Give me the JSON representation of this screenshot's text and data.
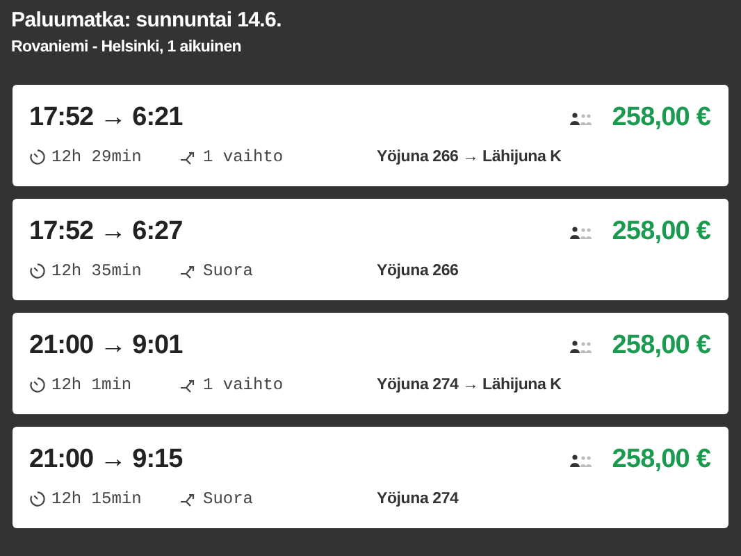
{
  "header": {
    "title": "Paluumatka: sunnuntai 14.6.",
    "subtitle": "Rovaniemi - Helsinki, 1 aikuinen"
  },
  "connections": [
    {
      "times": "17:52 → 6:21",
      "price": "258,00 €",
      "duration": "12h 29min",
      "transfers": "1 vaihto",
      "trains": "Yöjuna 266 → Lähijuna K"
    },
    {
      "times": "17:52 → 6:27",
      "price": "258,00 €",
      "duration": "12h 35min",
      "transfers": "Suora",
      "trains": "Yöjuna 266"
    },
    {
      "times": "21:00 → 9:01",
      "price": "258,00 €",
      "duration": "12h 1min",
      "transfers": "1 vaihto",
      "trains": "Yöjuna 274 → Lähijuna K"
    },
    {
      "times": "21:00 → 9:15",
      "price": "258,00 €",
      "duration": "12h 15min",
      "transfers": "Suora",
      "trains": "Yöjuna 274"
    }
  ]
}
